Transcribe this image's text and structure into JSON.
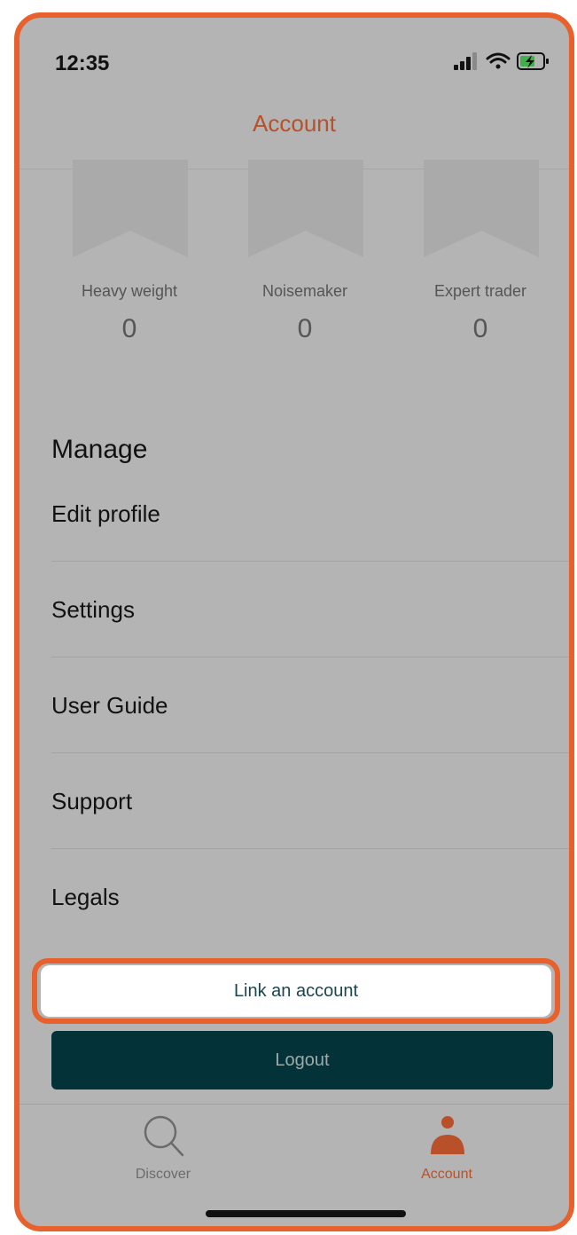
{
  "status_bar": {
    "time": "12:35"
  },
  "header": {
    "title": "Account"
  },
  "badges": [
    {
      "label": "Heavy weight",
      "count": "0"
    },
    {
      "label": "Noisemaker",
      "count": "0"
    },
    {
      "label": "Expert trader",
      "count": "0"
    }
  ],
  "manage": {
    "heading": "Manage",
    "items": [
      {
        "label": "Edit profile"
      },
      {
        "label": "Settings"
      },
      {
        "label": "User Guide"
      },
      {
        "label": "Support"
      },
      {
        "label": "Legals"
      }
    ]
  },
  "buttons": {
    "link_account": "Link an account",
    "logout": "Logout"
  },
  "tabbar": {
    "discover": {
      "label": "Discover",
      "icon": "search-icon"
    },
    "account": {
      "label": "Account",
      "icon": "user-icon",
      "active": true
    }
  },
  "colors": {
    "accent": "#E8602C",
    "title": "#B8502A",
    "dark_teal": "#033339",
    "overlay": "#B4B4B4"
  }
}
